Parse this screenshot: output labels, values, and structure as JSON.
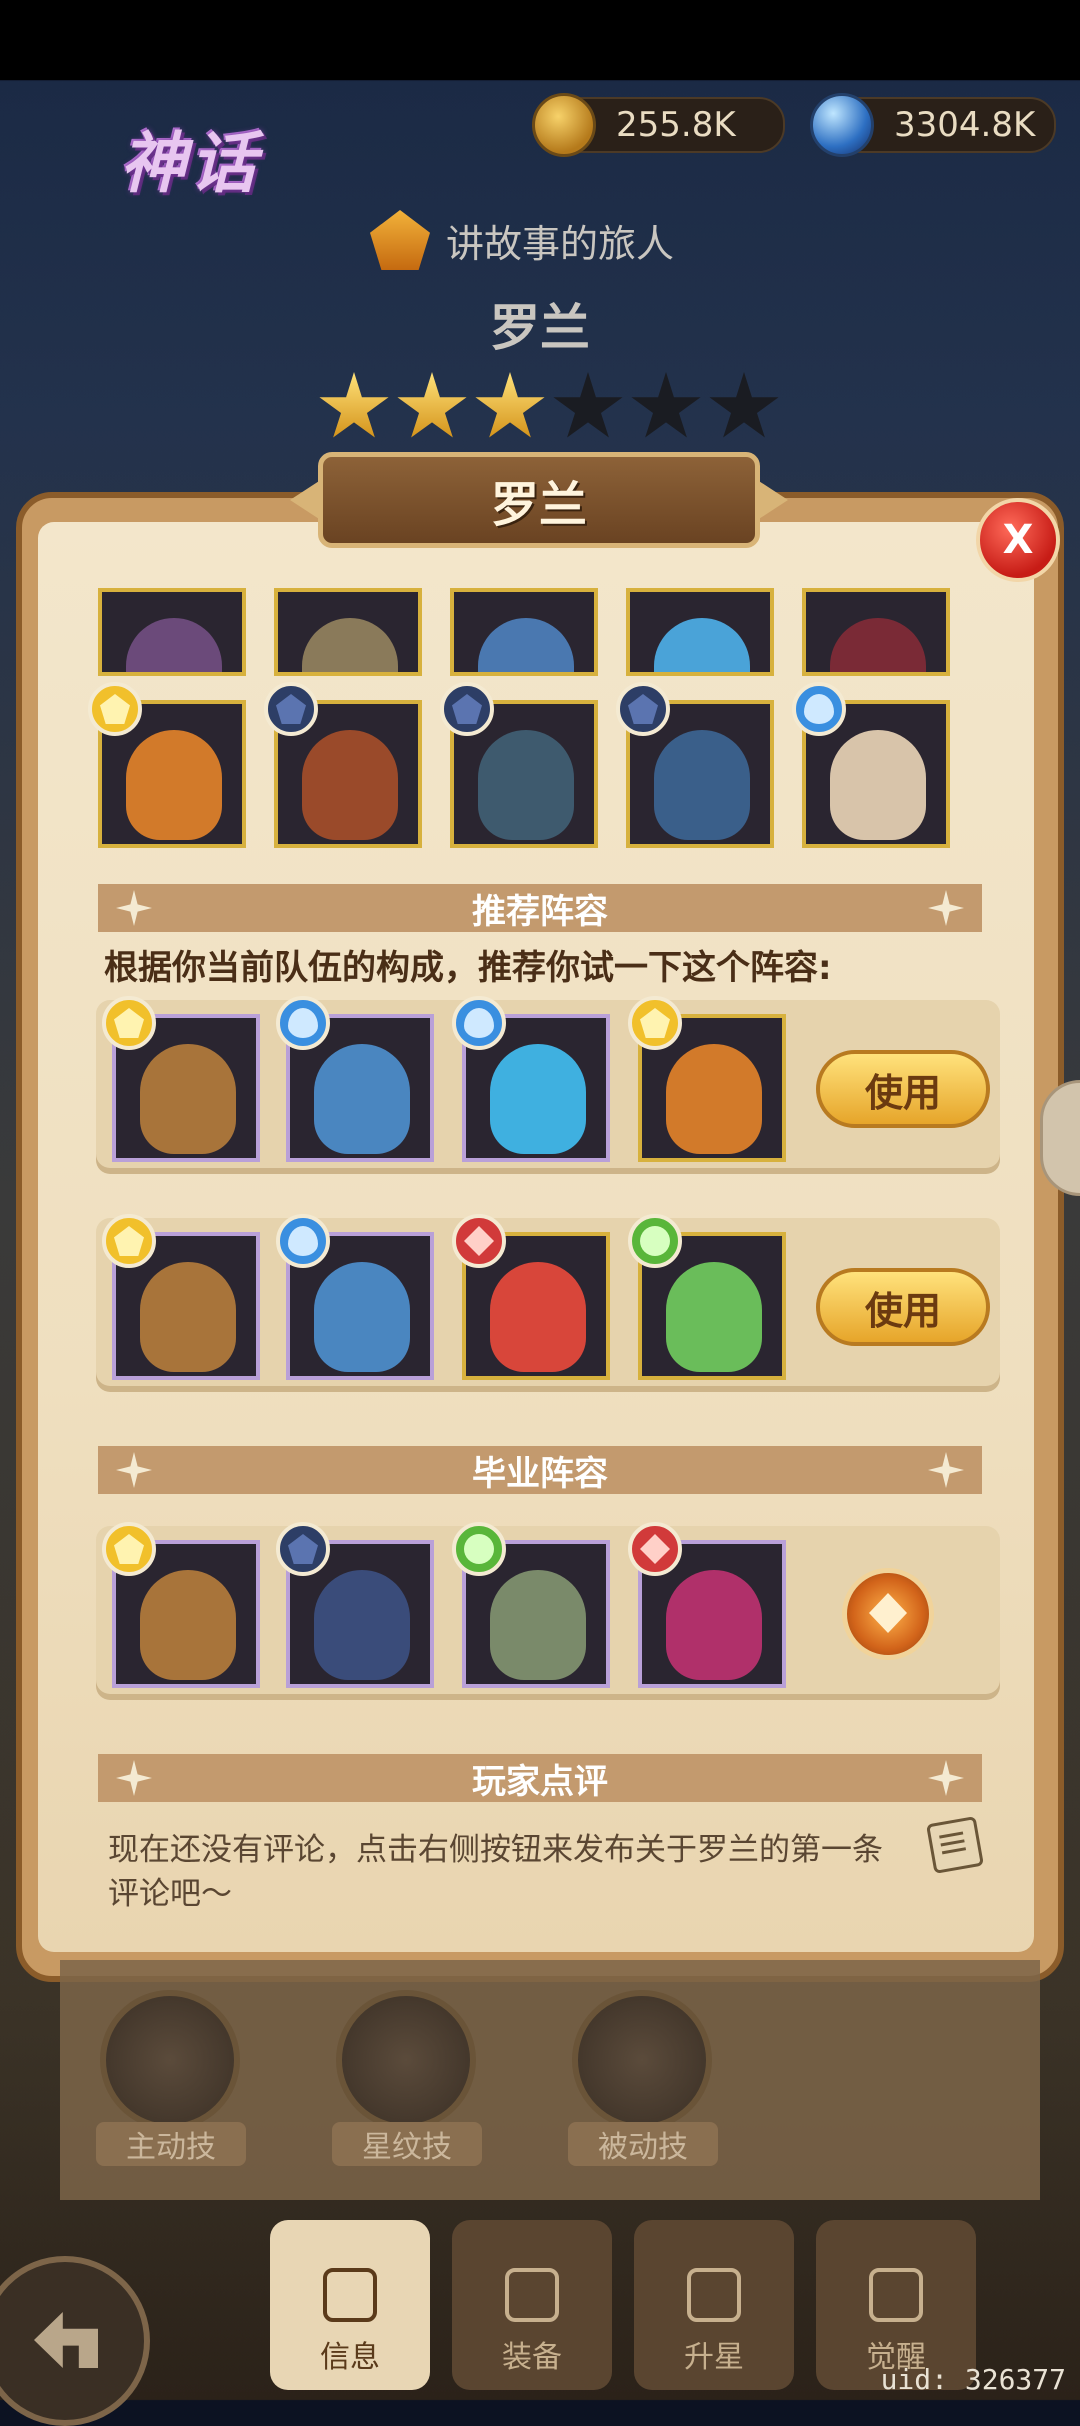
{
  "header": {
    "logo_title": "神话",
    "currencies": [
      {
        "icon": "gold-coin-icon",
        "value": "255.8K"
      },
      {
        "icon": "mana-orb-icon",
        "value": "3304.8K"
      }
    ],
    "hero_class": "讲故事的旅人",
    "hero_name": "罗兰",
    "stars": {
      "filled": 3,
      "total": 6
    }
  },
  "dialog": {
    "title": "罗兰",
    "close_label": "X",
    "hero_rows": {
      "row1_partial": [
        {
          "face_color": "#6b4a7a"
        },
        {
          "face_color": "#8a7a5a"
        },
        {
          "face_color": "#4a78b0"
        },
        {
          "face_color": "#4aa3d8"
        },
        {
          "face_color": "#7a2a36"
        }
      ],
      "row2": [
        {
          "element": "light",
          "face_color": "#d27a2a"
        },
        {
          "element": "dark",
          "face_color": "#9a4a2a"
        },
        {
          "element": "dark",
          "face_color": "#3e5a6e"
        },
        {
          "element": "dark",
          "face_color": "#3a5f8a"
        },
        {
          "element": "water",
          "face_color": "#d8c4aa"
        }
      ]
    },
    "recommended": {
      "title": "推荐阵容",
      "description": "根据你当前队伍的构成，推荐你试一下这个阵容:",
      "teams": [
        {
          "use_label": "使用",
          "heroes": [
            {
              "element": "light",
              "face_color": "#a8743a",
              "frame": "purple"
            },
            {
              "element": "water",
              "face_color": "#4a86c0",
              "frame": "purple"
            },
            {
              "element": "water",
              "face_color": "#3fb0e0",
              "frame": "purple"
            },
            {
              "element": "light",
              "face_color": "#d27a2a",
              "frame": "gold"
            }
          ]
        },
        {
          "use_label": "使用",
          "heroes": [
            {
              "element": "light",
              "face_color": "#a8743a",
              "frame": "purple"
            },
            {
              "element": "water",
              "face_color": "#4a86c0",
              "frame": "purple"
            },
            {
              "element": "fire",
              "face_color": "#d8463a",
              "frame": "gold"
            },
            {
              "element": "nature",
              "face_color": "#6abd5a",
              "frame": "gold"
            }
          ]
        }
      ]
    },
    "graduation": {
      "title": "毕业阵容",
      "heroes": [
        {
          "element": "light",
          "face_color": "#a8743a",
          "frame": "purple"
        },
        {
          "element": "dark",
          "face_color": "#3a4c7a",
          "frame": "purple"
        },
        {
          "element": "nature",
          "face_color": "#7a8a6a",
          "frame": "purple"
        },
        {
          "element": "fire",
          "face_color": "#b0306a",
          "frame": "purple"
        }
      ]
    },
    "reviews": {
      "title": "玩家点评",
      "empty_text": "现在还没有评论，点击右侧按钮来发布关于罗兰的第一条评论吧～"
    }
  },
  "skills": [
    {
      "label": "主动技"
    },
    {
      "label": "星纹技"
    },
    {
      "label": "被动技"
    }
  ],
  "tabs": [
    {
      "label": "信息",
      "active": true
    },
    {
      "label": "装备",
      "active": false
    },
    {
      "label": "升星",
      "active": false
    },
    {
      "label": "觉醒",
      "active": false
    }
  ],
  "uid": "uid: 326377"
}
